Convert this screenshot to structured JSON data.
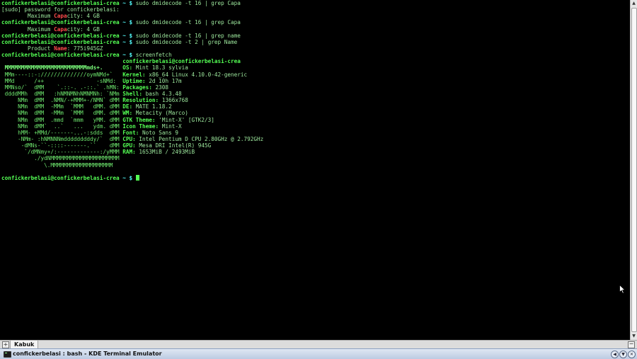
{
  "terminal": {
    "lines": [
      {
        "prompt": "confickerbelasi@confickerbelasi-crea",
        "cmd": "sudo dmidecode -t 16 | grep Capa"
      },
      {
        "text": "[sudo] password for confickerbelasi:"
      },
      {
        "pre": "        Maximum ",
        "match": "Capa",
        "post": "city: 4 GB"
      },
      {
        "prompt": "confickerbelasi@confickerbelasi-crea",
        "cmd": "sudo dmidecode -t 16 | grep Capa"
      },
      {
        "pre": "        Maximum ",
        "match": "Capa",
        "post": "city: 4 GB"
      },
      {
        "prompt": "confickerbelasi@confickerbelasi-crea",
        "cmd": "sudo dmidecode -t 16 | grep name"
      },
      {
        "prompt": "confickerbelasi@confickerbelasi-crea",
        "cmd": "sudo dmidecode -t 2 | grep Name"
      },
      {
        "pre": "        Product ",
        "match": "Name",
        "post": ": 775i945GZ"
      },
      {
        "prompt": "confickerbelasi@confickerbelasi-crea",
        "cmd": "screenfetch"
      }
    ],
    "screenfetch": {
      "ascii": [
        "                                   ",
        " MMMMMMMMMMMMMMMMMMMMMMMMMmds+.    ",
        " MMm----::-://////////////oymNMd+` ",
        " MMd      /++                -sNMd:",
        " MMNso/`  dMM    `.::-. .-::.` .hMN:",
        " ddddMMh  dMM   :hNMNMNhNMNMNh: `NMm",
        "     NMm  dMM  .NMN/-+MMM+-/NMN` dMM",
        "     NMm  dMM  -MMm  `MMM   dMM. dMM",
        "     NMm  dMM  -MMm  `MMM   dMM. dMM",
        "     NMm  dMM  .mmd  `mmm   yMM. dMM",
        "     NMm  dMM`  ..`   ...   ydm. dMM",
        "     hMM- +MMd/-------...-:sdds  dMM",
        "     -NMm- :hNMNNNmdddddddddy/`  dMM",
        "      -dMNs-``-::::-------.``    dMM",
        "       `/dMNmy+/:-------------:/yMMM",
        "          ./ydNMMMMMMMMMMMMMMMMMMMMM",
        "             \\.MMMMMMMMMMMMMMMMMMM  "
      ],
      "header": "confickerbelasi@confickerbelasi-crea",
      "info": [
        {
          "key": "OS:",
          "value": "Mint 18.3 sylvia"
        },
        {
          "key": "Kernel:",
          "value": "x86_64 Linux 4.10.0-42-generic"
        },
        {
          "key": "Uptime:",
          "value": "2d 10h 17m"
        },
        {
          "key": "Packages:",
          "value": "2308"
        },
        {
          "key": "Shell:",
          "value": "bash 4.3.48"
        },
        {
          "key": "Resolution:",
          "value": "1366x768"
        },
        {
          "key": "DE:",
          "value": "MATE 1.18.2"
        },
        {
          "key": "WM:",
          "value": "Metacity (Marco)"
        },
        {
          "key": "GTK Theme:",
          "value": "'Mint-X' [GTK2/3]"
        },
        {
          "key": "Icon Theme:",
          "value": "Mint-X"
        },
        {
          "key": "Font:",
          "value": "Noto Sans 9"
        },
        {
          "key": "CPU:",
          "value": "Intel Pentium D CPU 2.80GHz @ 2.792GHz"
        },
        {
          "key": "GPU:",
          "value": "Mesa DRI Intel(R) 945G"
        },
        {
          "key": "RAM:",
          "value": "1653MiB / 2493MiB"
        }
      ]
    },
    "final_prompt": "confickerbelasi@confickerbelasi-crea",
    "prompt_symbol": "$",
    "prompt_arrow": "~"
  },
  "tabbar": {
    "new_tab": "+",
    "tabs": [
      {
        "label": "Kabuk"
      }
    ],
    "close_tab": "−"
  },
  "taskbar": {
    "window_title": "confickerbelasi : bash - KDE Terminal Emulator"
  },
  "colors": {
    "prompt_user": "#54ff54",
    "prompt_path": "#54ffff",
    "grep_match": "#ff4b4b",
    "command_text": "#9de89d",
    "background": "#000000"
  }
}
